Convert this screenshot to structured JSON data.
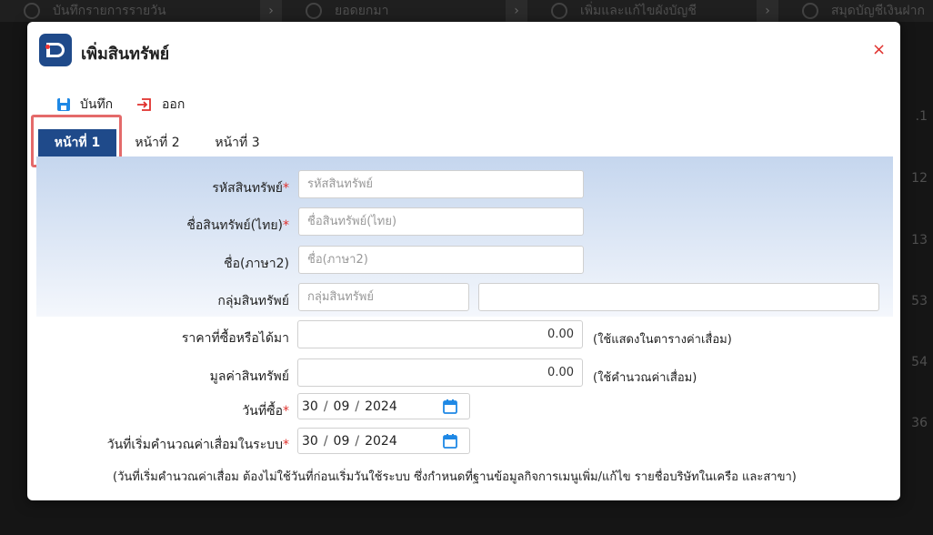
{
  "background": {
    "segments": [
      {
        "label": "บันทึกรายการรายวัน"
      },
      {
        "label": "ยอดยกมา"
      },
      {
        "label": "เพิ่มและแก้ไขผังบัญชี"
      },
      {
        "label": "สมุดบัญชีเงินฝาก"
      }
    ],
    "side_numbers": [
      ".1",
      "12",
      "13",
      "53",
      "54",
      "36"
    ]
  },
  "modal": {
    "title": "เพิ่มสินทรัพย์",
    "close_symbol": "×"
  },
  "toolbar": {
    "save_label": "บันทึก",
    "exit_label": "ออก"
  },
  "tabs": [
    {
      "label": "หน้าที่ 1",
      "active": true
    },
    {
      "label": "หน้าที่ 2",
      "active": false
    },
    {
      "label": "หน้าที่ 3",
      "active": false
    }
  ],
  "form": {
    "asset_code": {
      "label": "รหัสสินทรัพย์",
      "required": true,
      "placeholder": "รหัสสินทรัพย์",
      "value": ""
    },
    "asset_name_th": {
      "label": "ชื่อสินทรัพย์(ไทย)",
      "required": true,
      "placeholder": "ชื่อสินทรัพย์(ไทย)",
      "value": ""
    },
    "name_lang2": {
      "label": "ชื่อ(ภาษา2)",
      "required": false,
      "placeholder": "ชื่อ(ภาษา2)",
      "value": ""
    },
    "asset_group": {
      "label": "กลุ่มสินทรัพย์",
      "required": false,
      "placeholder": "กลุ่มสินทรัพย์",
      "value": "",
      "name_value": ""
    },
    "purchase_price": {
      "label": "ราคาที่ซื้อหรือได้มา",
      "value": "0.00",
      "note": "(ใช้แสดงในตารางค่าเสื่อม)"
    },
    "asset_value": {
      "label": "มูลค่าสินทรัพย์",
      "value": "0.00",
      "note": "(ใช้คำนวณค่าเสื่อม)"
    },
    "purchase_date": {
      "label": "วันที่ซื้อ",
      "required": true,
      "day": "30",
      "month": "09",
      "year": "2024",
      "separator": "/"
    },
    "depreciation_start_date": {
      "label": "วันที่เริ่มคำนวณค่าเสื่อมในระบบ",
      "required": true,
      "day": "30",
      "month": "09",
      "year": "2024",
      "separator": "/"
    },
    "footnote": "(วันที่เริ่มคำนวณค่าเสื่อม ต้องไม่ใช้วันที่ก่อนเริ่มวันใช้ระบบ ซึ่งกำหนดที่ฐานข้อมูลกิจการเมนูเพิ่ม/แก้ไข รายชื่อบริษัทในเครือ และสาขา)",
    "required_mark": "*"
  },
  "colors": {
    "brand": "#1f4a8a",
    "required": "#e0302c",
    "close": "#e0302c",
    "highlight": "#e46a6a",
    "calendar_icon": "#1e88e5"
  },
  "icons": {
    "save": "floppy-disk-icon",
    "exit": "exit-arrow-icon",
    "calendar": "calendar-icon",
    "close": "close-icon"
  }
}
